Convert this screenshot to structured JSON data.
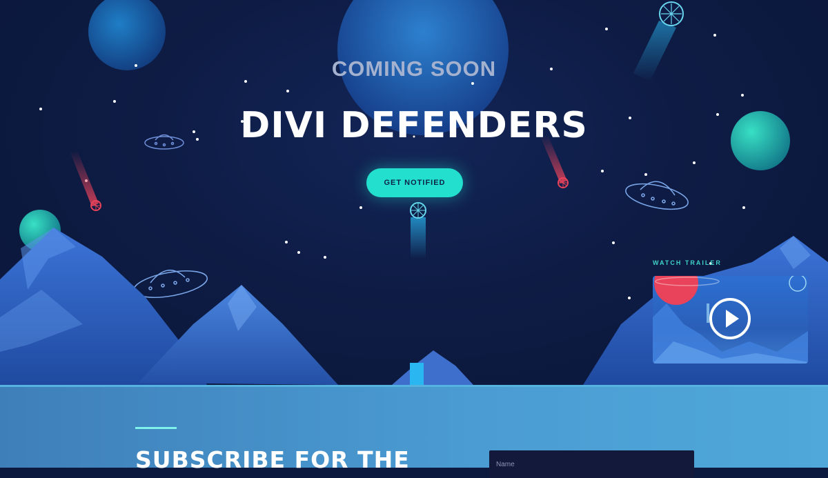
{
  "hero": {
    "eyebrow": "COMING SOON",
    "title": "DIVI DEFENDERS",
    "cta_label": "GET NOTIFIED"
  },
  "trailer": {
    "label": "WATCH TRAILER",
    "play_icon": "play-icon"
  },
  "subscribe": {
    "heading": "SUBSCRIBE FOR THE",
    "name_placeholder": "Name"
  },
  "colors": {
    "background": "#0d1a3f",
    "accent": "#22e0cd",
    "mountain": "#2b5fc4",
    "subscribe_band": "#4a9bd2",
    "meteor_red": "#e8435a"
  }
}
